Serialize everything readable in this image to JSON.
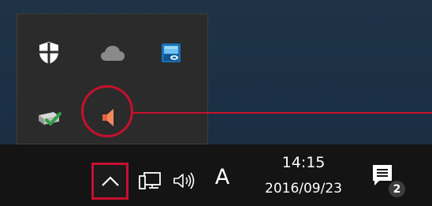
{
  "tray_popup": {
    "icons": [
      {
        "name": "windows-defender-shield-icon"
      },
      {
        "name": "onedrive-cloud-icon"
      },
      {
        "name": "network-drive-app-icon"
      },
      {
        "name": "printer-check-icon"
      },
      {
        "name": "speaker-muted-icon"
      }
    ]
  },
  "taskbar": {
    "show_hidden_icons": {
      "icon": "chevron-up-icon"
    },
    "network_icon": "network-monitor-icon",
    "volume_icon": "speaker-volume-icon",
    "ime_indicator": "A",
    "clock": {
      "time": "14:15",
      "date": "2016/09/23"
    },
    "action_center": {
      "icon": "notification-icon",
      "badge_count": "2"
    }
  },
  "colors": {
    "highlight": "#c8102e",
    "taskbar_bg": "#141414",
    "popup_bg": "#2b2b2b"
  }
}
